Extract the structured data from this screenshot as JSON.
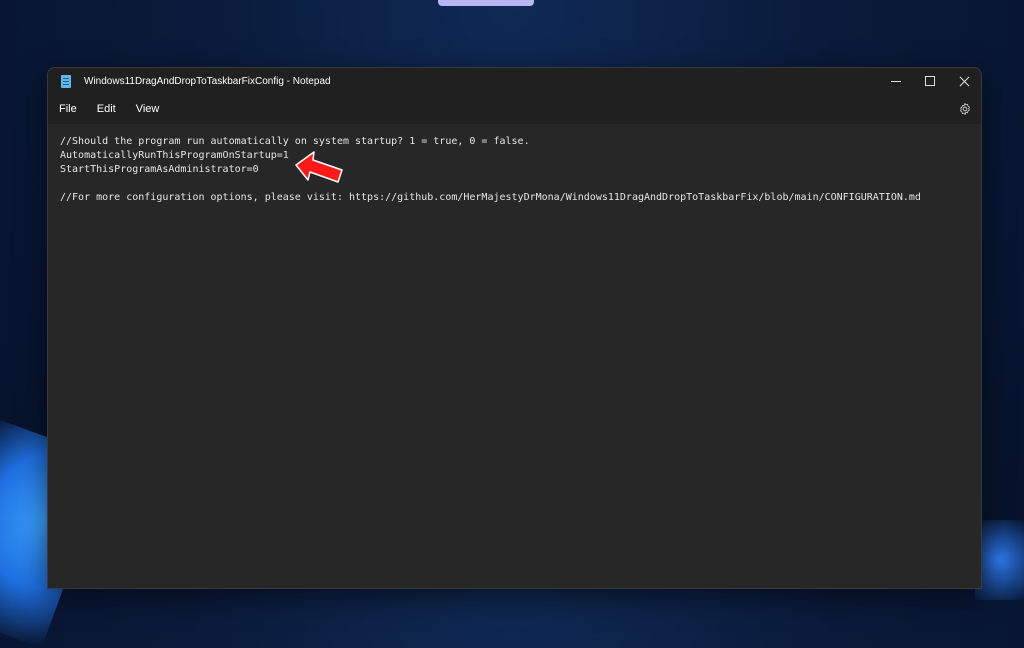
{
  "window": {
    "title": "Windows11DragAndDropToTaskbarFixConfig - Notepad"
  },
  "menu": {
    "items": [
      "File",
      "Edit",
      "View"
    ]
  },
  "editor": {
    "lines": [
      "//Should the program run automatically on system startup? 1 = true, 0 = false.",
      "AutomaticallyRunThisProgramOnStartup=1",
      "StartThisProgramAsAdministrator=0",
      "",
      "//For more configuration options, please visit: https://github.com/HerMajestyDrMona/Windows11DragAndDropToTaskbarFix/blob/main/CONFIGURATION.md"
    ]
  },
  "icons": {
    "app": "notepad-icon",
    "minimize": "minimize-icon",
    "maximize": "maximize-icon",
    "close": "close-icon",
    "settings": "gear-icon",
    "annotation": "red-arrow-icon"
  },
  "colors": {
    "editor_bg": "#272727",
    "titlebar_bg": "#202020",
    "text": "#e6e6e6",
    "annotation": "#ff1a1a",
    "desktop_bg": "#0a1a3a"
  }
}
